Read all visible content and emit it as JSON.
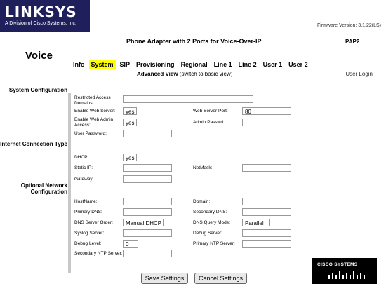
{
  "brand": {
    "logo_text": "LINKSYS",
    "logo_subtitle": "A Division of Cisco Systems, Inc."
  },
  "firmware": "Firmware Version: 3.1.22(LS)",
  "product_title": "Phone Adapter with 2 Ports for Voice-Over-IP",
  "model": "PAP2",
  "section": "Voice",
  "tabs": [
    {
      "label": "Info",
      "active": false
    },
    {
      "label": "System",
      "active": true
    },
    {
      "label": "SIP",
      "active": false
    },
    {
      "label": "Provisioning",
      "active": false
    },
    {
      "label": "Regional",
      "active": false
    },
    {
      "label": "Line 1",
      "active": false
    },
    {
      "label": "Line 2",
      "active": false
    },
    {
      "label": "User 1",
      "active": false
    },
    {
      "label": "User 2",
      "active": false
    }
  ],
  "view": {
    "advanced": "Advanced View",
    "switch": "(switch to basic view)"
  },
  "user_login": "User Login",
  "sections": {
    "system": "System Configuration",
    "internet": "Internet Connection Type",
    "optional": "Optional Network Configuration"
  },
  "fields": {
    "restricted_access_domains": {
      "label": "Restricted Access Domains:",
      "value": ""
    },
    "enable_web_server": {
      "label": "Enable Web Server:",
      "value": "yes"
    },
    "web_server_port": {
      "label": "Web Server Port:",
      "value": "80"
    },
    "enable_web_admin": {
      "label": "Enable Web Admin Access:",
      "value": "yes"
    },
    "admin_passwd": {
      "label": "Admin Passwd:",
      "value": ""
    },
    "user_password": {
      "label": "User Password:",
      "value": ""
    },
    "dhcp": {
      "label": "DHCP:",
      "value": "yes"
    },
    "static_ip": {
      "label": "Static IP:",
      "value": ""
    },
    "netmask": {
      "label": "NetMask:",
      "value": ""
    },
    "gateway": {
      "label": "Gateway:",
      "value": ""
    },
    "hostname": {
      "label": "HostName:",
      "value": ""
    },
    "domain": {
      "label": "Domain:",
      "value": ""
    },
    "primary_dns": {
      "label": "Primary DNS:",
      "value": ""
    },
    "secondary_dns": {
      "label": "Secondary DNS:",
      "value": ""
    },
    "dns_server_order": {
      "label": "DNS Server Order:",
      "value": "Manual,DHCP"
    },
    "dns_query_mode": {
      "label": "DNS Query Mode:",
      "value": "Parallel"
    },
    "syslog_server": {
      "label": "Syslog Server:",
      "value": ""
    },
    "debug_server": {
      "label": "Debug Server:",
      "value": ""
    },
    "debug_level": {
      "label": "Debug Level:",
      "value": "0"
    },
    "primary_ntp": {
      "label": "Primary NTP Server:",
      "value": ""
    },
    "secondary_ntp": {
      "label": "Secondary NTP Server:",
      "value": ""
    }
  },
  "buttons": {
    "save": "Save Settings",
    "cancel": "Cancel Settings"
  },
  "footer_logo": "CISCO SYSTEMS",
  "colors": {
    "brand_navy": "#1f1f5c",
    "active_tab": "#ffff00",
    "divider": "#c8c8c8"
  }
}
